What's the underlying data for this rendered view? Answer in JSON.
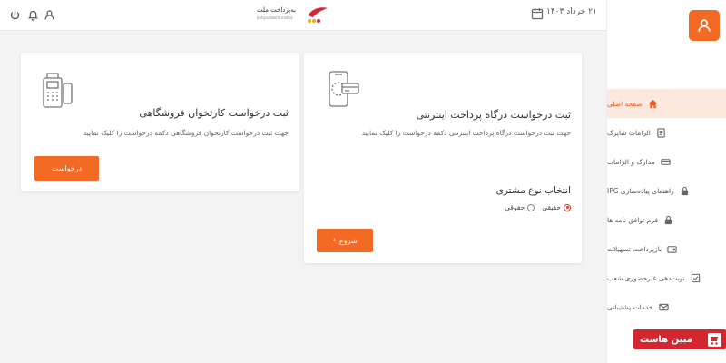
{
  "topbar": {
    "logo_name": "به‌پرداخت ملت",
    "logo_sub": "behpardakht mellat",
    "date": "۲۱ خرداد ۱۴۰۳",
    "icons": [
      "power-icon",
      "bell-icon",
      "user-icon",
      "calendar-icon"
    ]
  },
  "sidebar": {
    "items": [
      {
        "label": "صفحه اصلی",
        "icon": "home-icon",
        "active": true
      },
      {
        "label": "الزامات شاپرک",
        "icon": "document-icon"
      },
      {
        "label": "مدارک و الزامات",
        "icon": "card-icon"
      },
      {
        "label": "راهنمای پیاده‌سازی IPG",
        "icon": "lock-icon"
      },
      {
        "label": "فرم توافق نامه ها",
        "icon": "lock-icon"
      },
      {
        "label": "بازپرداخت تسهیلات",
        "icon": "wallet-icon"
      },
      {
        "label": "نوبت‌دهی غیرحضوری شعب",
        "icon": "check-icon"
      },
      {
        "label": "خدمات پشتیبانی",
        "icon": "mail-icon"
      }
    ]
  },
  "ipg_card": {
    "title": "ثبت درخواست درگاه پرداخت اینترنتی",
    "description": "جهت ثبت درخواست درگاه پرداخت اینترنتی دکمه درخواست را کلیک نمایید",
    "customer_type_label": "انتخاب نوع مشتری",
    "options": [
      "حقیقی",
      "حقوقی"
    ],
    "selected": "حقیقی",
    "start_button": "شروع"
  },
  "pos_card": {
    "title": "ثبت درخواست کارتخوان فروشگاهی",
    "description": "جهت ثبت درخواست کارتخوان فروشگاهی دکمه درخواست را کلیک نمایید",
    "request_button": "درخواست"
  },
  "watermark": {
    "text": "مبین هاست"
  },
  "colors": {
    "accent": "#f26a24",
    "active_bg": "#fbe9e0",
    "radio": "#e2362b",
    "watermark": "#d42630"
  }
}
